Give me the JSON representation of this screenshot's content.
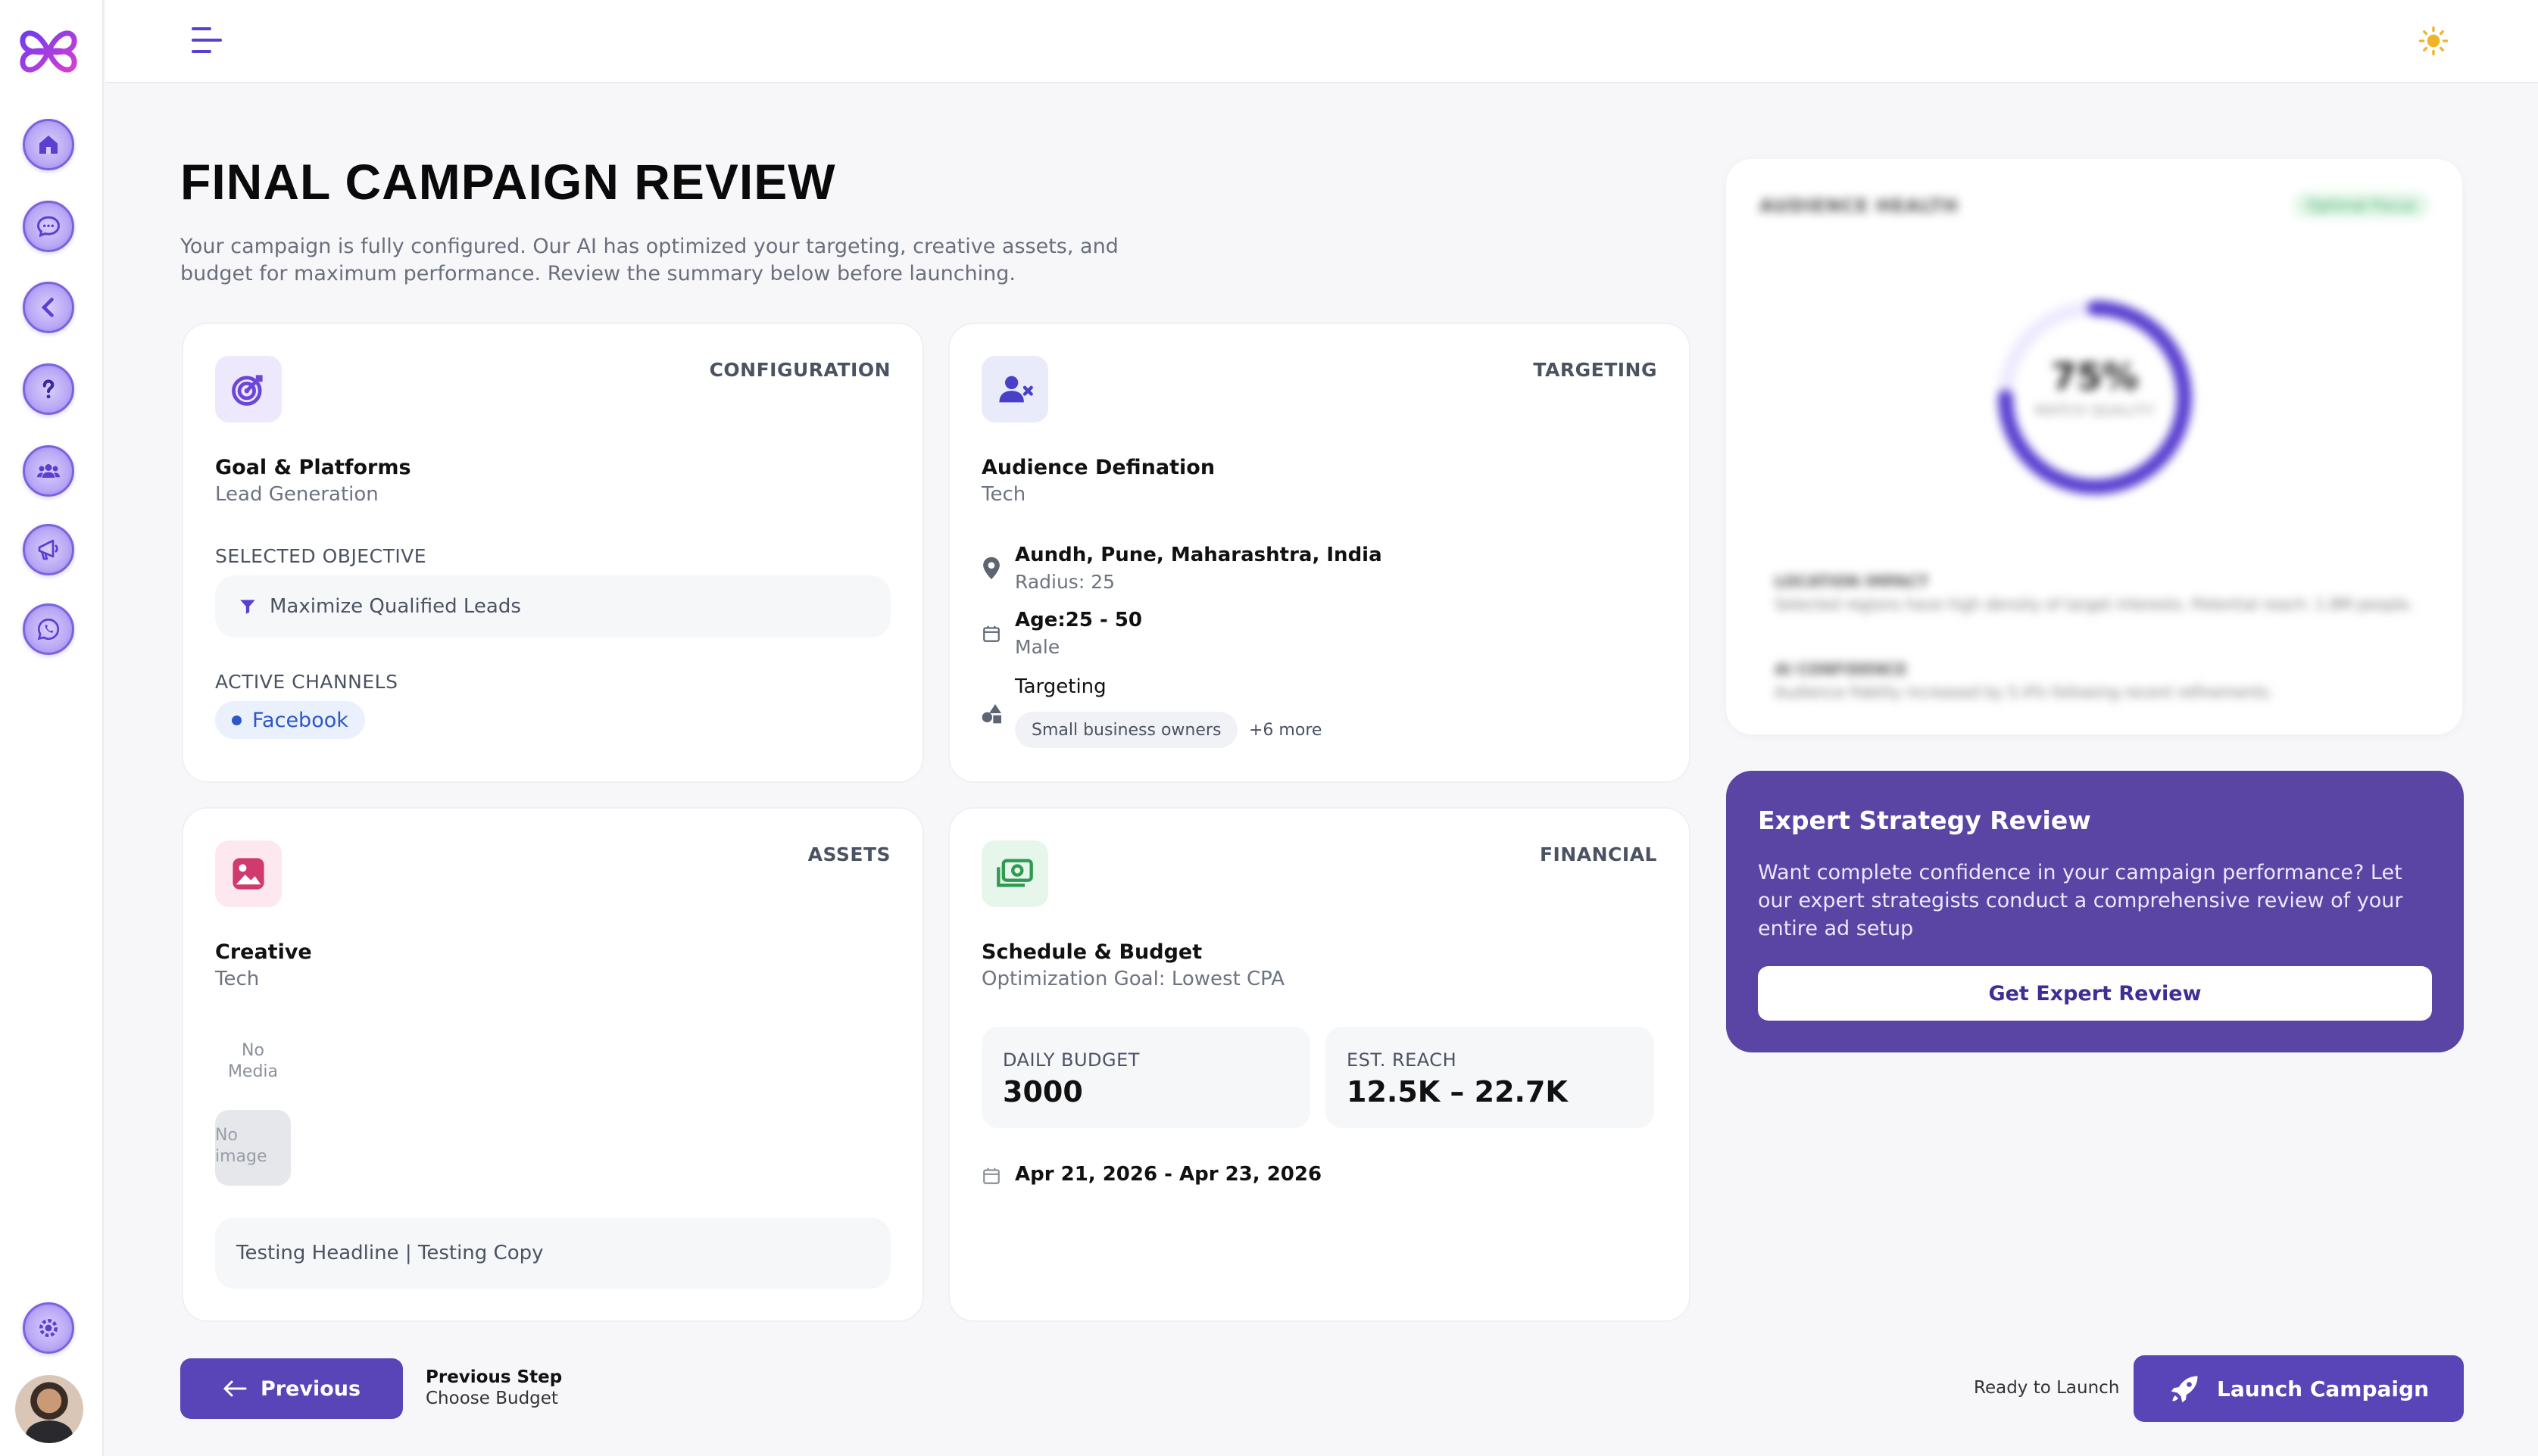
{
  "page": {
    "title": "FINAL CAMPAIGN REVIEW",
    "subtitle": "Your campaign is fully configured. Our AI has optimized your targeting, creative assets, and budget for maximum performance. Review the summary below before launching."
  },
  "sidebar": {
    "items": [
      {
        "icon": "home-icon"
      },
      {
        "icon": "chat-icon"
      },
      {
        "icon": "chevron-left-icon"
      },
      {
        "icon": "help-icon"
      },
      {
        "icon": "users-icon"
      },
      {
        "icon": "megaphone-icon"
      },
      {
        "icon": "whatsapp-icon"
      }
    ],
    "settings_icon": "settings-icon",
    "accent": "#7b63df"
  },
  "configuration": {
    "tag": "CONFIGURATION",
    "title": "Goal & Platforms",
    "subtitle": "Lead Generation",
    "objective_label": "SELECTED OBJECTIVE",
    "objective_value": "Maximize Qualified Leads",
    "channels_label": "ACTIVE CHANNELS",
    "channel": "Facebook"
  },
  "targeting": {
    "tag": "TARGETING",
    "title": "Audience Defination",
    "subtitle": "Tech",
    "location": "Aundh, Pune, Maharashtra, India",
    "radius": "Radius: 25",
    "age": "Age:25 - 50",
    "gender": "Male",
    "targeting_label": "Targeting",
    "interest_chip": "Small business owners",
    "more": "+6 more"
  },
  "assets": {
    "tag": "ASSETS",
    "title": "Creative",
    "subtitle": "Tech",
    "no_media": "No Media",
    "no_image": "No image",
    "copy": "Testing Headline | Testing Copy"
  },
  "financial": {
    "tag": "FINANCIAL",
    "title": "Schedule & Budget",
    "subtitle": "Optimization Goal: Lowest CPA",
    "daily_budget_label": "DAILY BUDGET",
    "daily_budget_value": "3000",
    "reach_label": "EST. REACH",
    "reach_value": "12.5K – 22.7K",
    "dates": "Apr 21, 2026 - Apr 23, 2026"
  },
  "health": {
    "title": "AUDIENCE HEALTH",
    "badge": "Optimal Focus",
    "ring_value": "75%",
    "ring_fraction": 0.75,
    "ring_label": "MATCH QUALITY",
    "insight1_title": "LOCATION IMPACT",
    "insight1_text": "Selected regions have high density of target interests. Potential reach: 1.8M people.",
    "insight2_title": "AI CONFIDENCE",
    "insight2_text": "Audience fidelity increased by 5.4% following recent refinements."
  },
  "expert": {
    "title": "Expert Strategy Review",
    "text": "Want complete confidence in your campaign performance? Let our expert strategists conduct a comprehensive review of your entire ad setup",
    "button": "Get Expert Review"
  },
  "footer": {
    "previous_button": "Previous",
    "previous_step_label": "Previous Step",
    "previous_step_name": "Choose Budget",
    "ready_text": "Ready to Launch",
    "launch_button": "Launch Campaign"
  },
  "colors": {
    "primary": "#5a45b8",
    "expert_bg": "#5a45a5",
    "facebook": "#2d57c8",
    "sun": "#f0b429"
  }
}
